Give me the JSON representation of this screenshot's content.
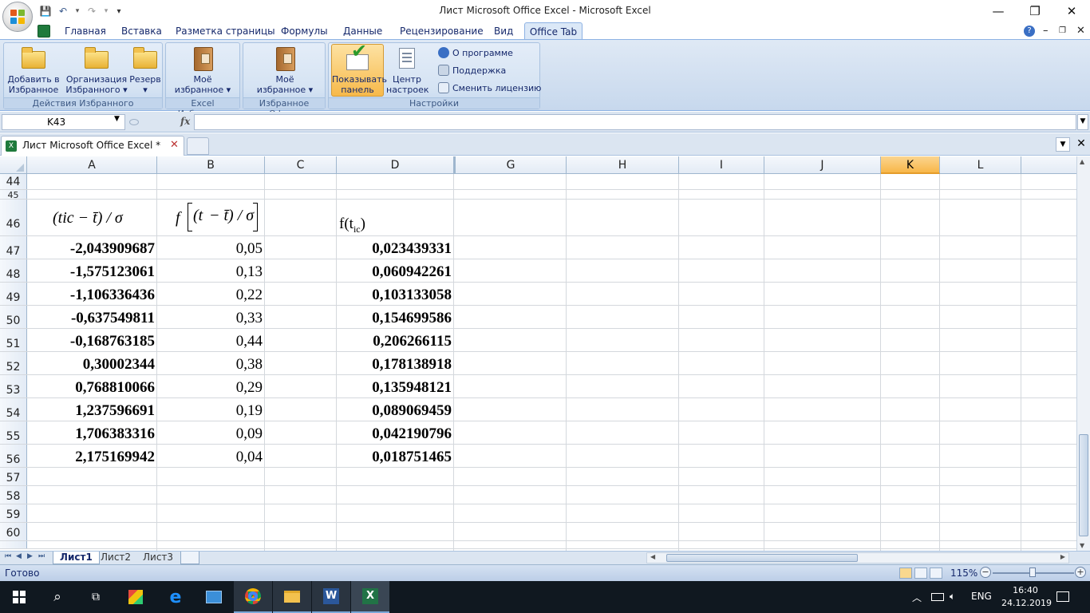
{
  "window": {
    "title": "Лист Microsoft Office Excel - Microsoft Excel",
    "minimize": "—",
    "restore": "❐",
    "close": "✕"
  },
  "qat": {
    "save": "💾",
    "undo": "↶",
    "redo": "↷",
    "more": "▾"
  },
  "ribbon_tabs": [
    "Главная",
    "Вставка",
    "Разметка страницы",
    "Формулы",
    "Данные",
    "Рецензирование",
    "Вид",
    "Office Tab"
  ],
  "ribbon": {
    "groups": {
      "favorites_actions": "Действия Избранного",
      "excel_favorites": "Excel Избранное",
      "office_favorites": "Избранное Офиса",
      "settings": "Настройки"
    },
    "buttons": {
      "add_fav_1": "Добавить в",
      "add_fav_2": "Избранное ▾",
      "org_fav_1": "Организация",
      "org_fav_2": "Избранного ▾",
      "backup_1": "Резерв",
      "backup_2": "▾",
      "my_fav_excel_1": "Моё",
      "my_fav_excel_2": "избранное ▾",
      "my_fav_office_1": "Моё",
      "my_fav_office_2": "избранное ▾",
      "show_panel_1": "Показывать",
      "show_panel_2": "панель",
      "settings_center_1": "Центр",
      "settings_center_2": "настроек",
      "about": "О программе",
      "support": "Поддержка",
      "change_license": "Сменить лицензию"
    }
  },
  "formula_bar": {
    "name_box": "K43",
    "fx": "fx",
    "formula": ""
  },
  "doc_tab": {
    "title": "Лист Microsoft Office Excel *",
    "close": "✕",
    "menu": "▼",
    "close_all": "✕"
  },
  "columns": [
    "A",
    "B",
    "C",
    "D",
    "G",
    "H",
    "I",
    "J",
    "K",
    "L"
  ],
  "selected_column": "K",
  "rows": {
    "r44": "44",
    "r45": "45",
    "r46": "46",
    "data": [
      {
        "row": "47",
        "a": "-2,043909687",
        "b": "0,05",
        "d": "0,023439331"
      },
      {
        "row": "48",
        "a": "-1,575123061",
        "b": "0,13",
        "d": "0,060942261"
      },
      {
        "row": "49",
        "a": "-1,106336436",
        "b": "0,22",
        "d": "0,103133058"
      },
      {
        "row": "50",
        "a": "-0,637549811",
        "b": "0,33",
        "d": "0,154699586"
      },
      {
        "row": "51",
        "a": "-0,168763185",
        "b": "0,44",
        "d": "0,206266115"
      },
      {
        "row": "52",
        "a": "0,30002344",
        "b": "0,38",
        "d": "0,178138918"
      },
      {
        "row": "53",
        "a": "0,768810066",
        "b": "0,29",
        "d": "0,135948121"
      },
      {
        "row": "54",
        "a": "1,237596691",
        "b": "0,19",
        "d": "0,089069459"
      },
      {
        "row": "55",
        "a": "1,706383316",
        "b": "0,09",
        "d": "0,042190796"
      },
      {
        "row": "56",
        "a": "2,175169942",
        "b": "0,04",
        "d": "0,018751465"
      }
    ],
    "empty": [
      "57",
      "58",
      "59",
      "60"
    ]
  },
  "header_formulas": {
    "a46": "(tic − t̄) / σ",
    "b46_f": "f",
    "b46_inner": "(t",
    "b46_inner2": " − t̄) / σ",
    "d46_f": "f(t",
    "d46_sub": "ic",
    "d46_close": ")"
  },
  "sheets": [
    "Лист1",
    "Лист2",
    "Лист3"
  ],
  "status": {
    "text": "Готово",
    "zoom": "115%",
    "zoom_level_percent": 115
  },
  "taskbar": {
    "lang": "ENG",
    "time": "16:40",
    "date": "24.12.2019"
  }
}
